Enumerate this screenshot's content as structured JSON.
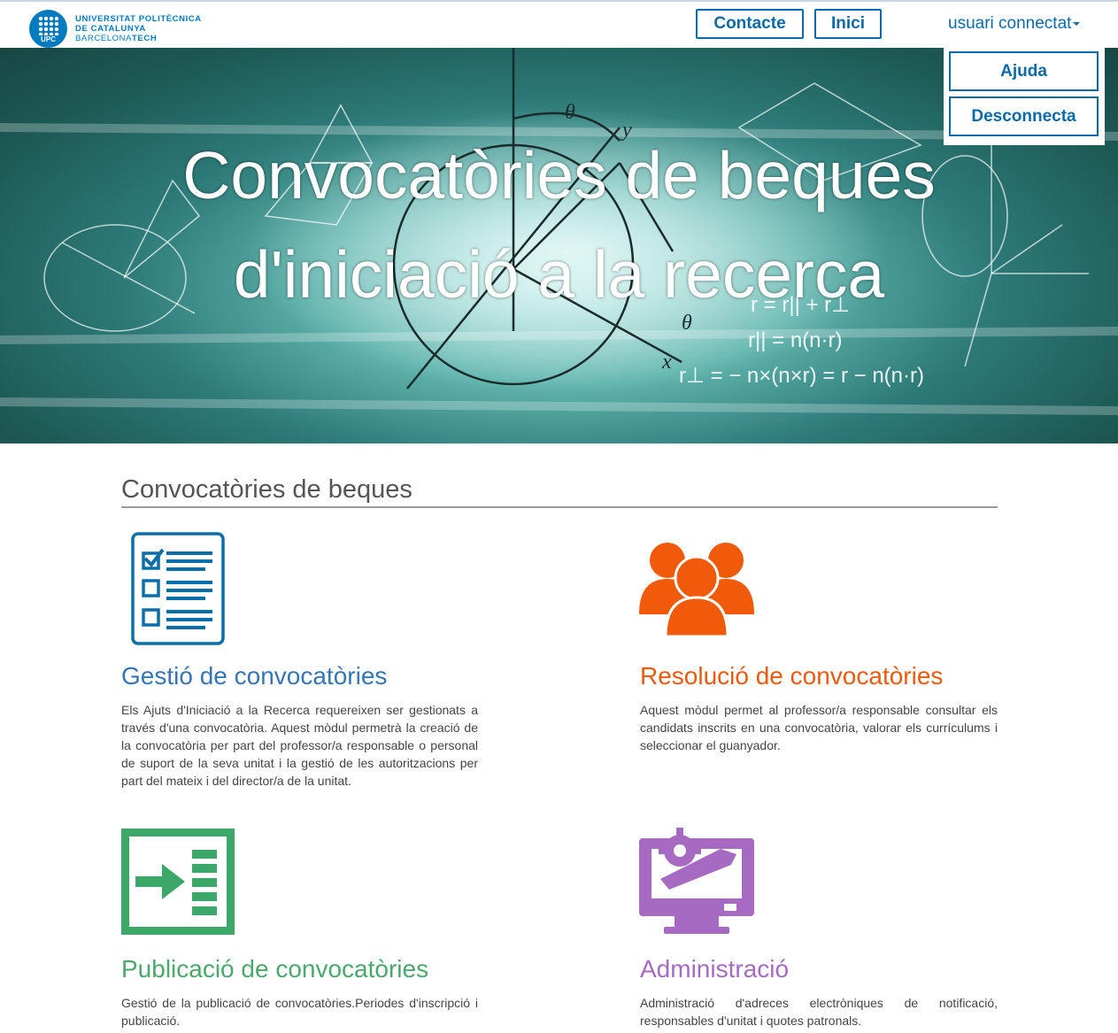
{
  "header": {
    "logo": {
      "badge": "UPC",
      "line1": "UNIVERSITAT POLITÈCNICA",
      "line2": "DE CATALUNYA",
      "line3_a": "BARCELONA",
      "line3_b": "TECH"
    },
    "contacte_label": "Contacte",
    "inici_label": "Inici",
    "user_label": "usuari connectat",
    "user_menu": {
      "ajuda_label": "Ajuda",
      "desconnecta_label": "Desconnecta"
    }
  },
  "hero": {
    "line1": "Convocatòries de beques",
    "line2": "d'iniciació a la recerca"
  },
  "main": {
    "section_title": "Convocatòries de beques",
    "cards": [
      {
        "title": "Gestió de convocatòries",
        "description": "Els Ajuts d'Iniciació a la Recerca requereixen ser gestionats a través d'una convocatòria. Aquest mòdul permetrà la creació de la convocatòria per part del professor/a responsable o personal de suport de la seva unitat i la gestió de les autoritzacions per part del mateix i del director/a de la unitat.",
        "icon": "checklist-icon",
        "color": "#3475b5"
      },
      {
        "title": "Resolució de convocatòries",
        "description": "Aquest mòdul permet al professor/a responsable consultar els candidats inscrits en una convocatòria, valorar els currículums i seleccionar el guanyador.",
        "icon": "users-group-icon",
        "color": "#ec5a0f"
      },
      {
        "title": "Publicació de convocatòries",
        "description": "Gestió de la publicació de convocatòries.Periodes d'inscripció i publicació.",
        "icon": "publish-list-icon",
        "color": "#4aa86d"
      },
      {
        "title": "Administració",
        "description": "Administració d'adreces electròniques de notificació, responsables d'unitat i quotes patronals.",
        "icon": "admin-monitor-icon",
        "color": "#a66ac2"
      }
    ]
  }
}
